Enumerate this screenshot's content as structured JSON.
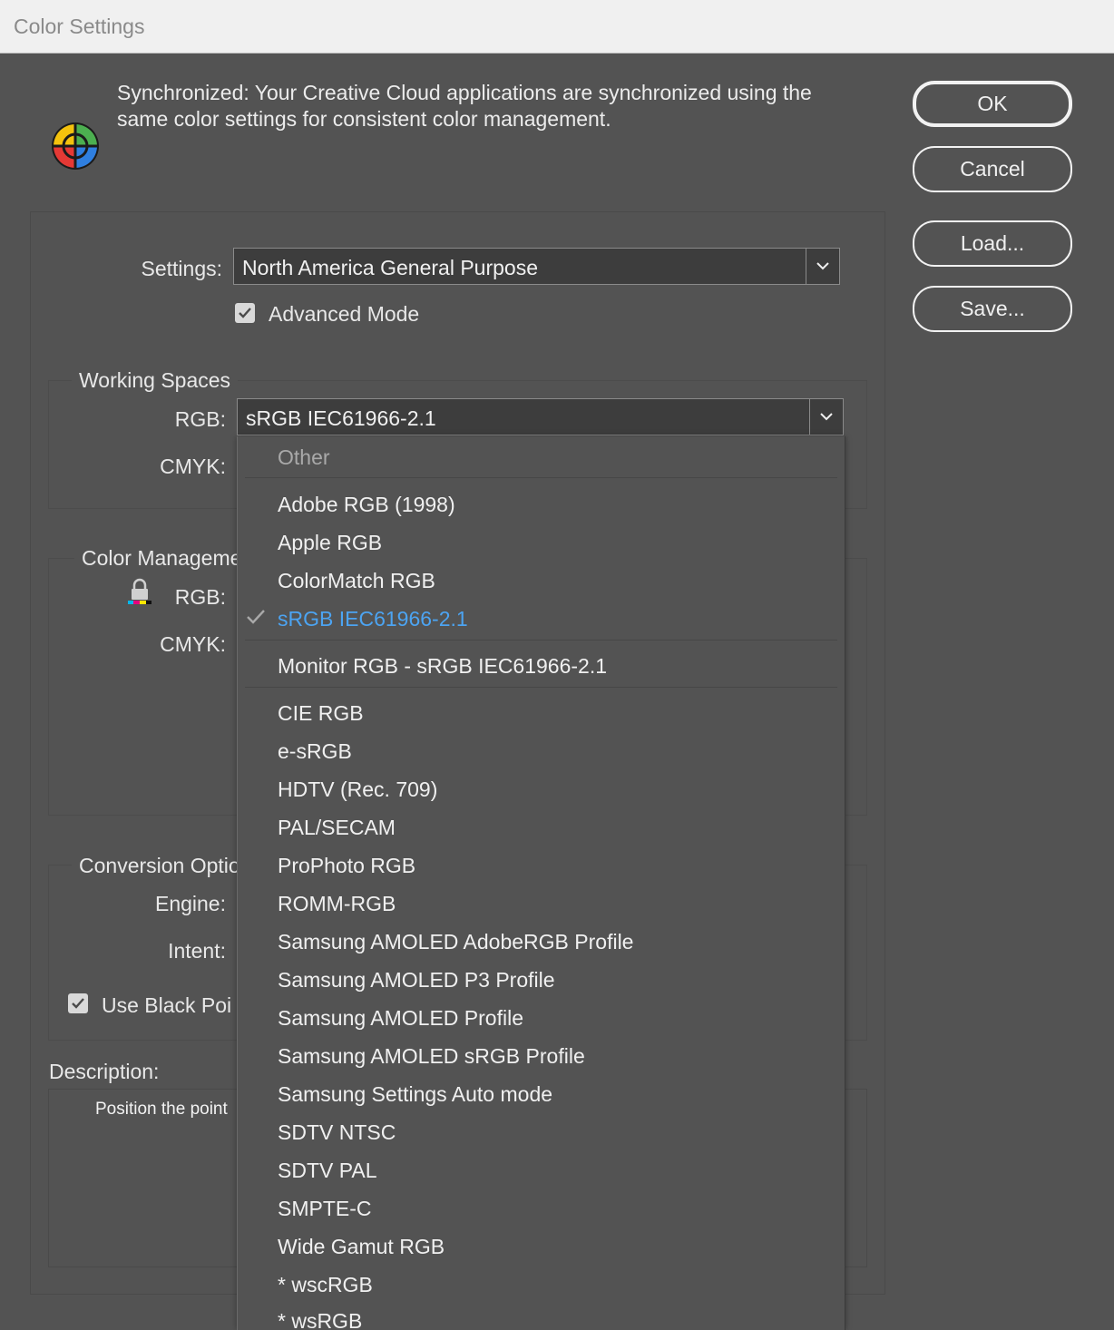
{
  "window": {
    "title": "Color Settings"
  },
  "sync": {
    "message": "Synchronized: Your Creative Cloud applications are synchronized using the same color settings for consistent color management."
  },
  "buttons": {
    "ok": "OK",
    "cancel": "Cancel",
    "load": "Load...",
    "save": "Save..."
  },
  "settings": {
    "label": "Settings:",
    "value": "North America General Purpose",
    "advanced_mode_label": "Advanced Mode",
    "advanced_mode_checked": true
  },
  "working_spaces": {
    "title": "Working Spaces",
    "rgb_label": "RGB:",
    "rgb_value": "sRGB IEC61966-2.1",
    "cmyk_label": "CMYK:"
  },
  "color_management": {
    "title": "Color Manageme",
    "rgb_label": "RGB:",
    "cmyk_label": "CMYK:"
  },
  "conversion": {
    "title": "Conversion Optio",
    "engine_label": "Engine:",
    "intent_label": "Intent:",
    "black_point_label": "Use Black Poi",
    "black_point_checked": true
  },
  "description": {
    "label": "Description:",
    "text": "Position the point"
  },
  "dropdown": {
    "header": "Other",
    "group1": [
      "Adobe RGB (1998)",
      "Apple RGB",
      "ColorMatch RGB"
    ],
    "selected": "sRGB IEC61966-2.1",
    "monitor": "Monitor RGB - sRGB IEC61966-2.1",
    "group3": [
      "CIE RGB",
      "e-sRGB",
      "HDTV (Rec. 709)",
      "PAL/SECAM",
      "ProPhoto RGB",
      "ROMM-RGB",
      "Samsung AMOLED AdobeRGB Profile",
      "Samsung AMOLED P3 Profile",
      "Samsung AMOLED Profile",
      "Samsung AMOLED sRGB Profile",
      "Samsung Settings Auto mode",
      "SDTV NTSC",
      "SDTV PAL",
      "SMPTE-C",
      "Wide Gamut RGB",
      "* wscRGB",
      "* wsRGB"
    ]
  },
  "colors": {
    "selected_item": "#4ca4f2",
    "background": "#535353",
    "field": "#3d3d3d"
  }
}
